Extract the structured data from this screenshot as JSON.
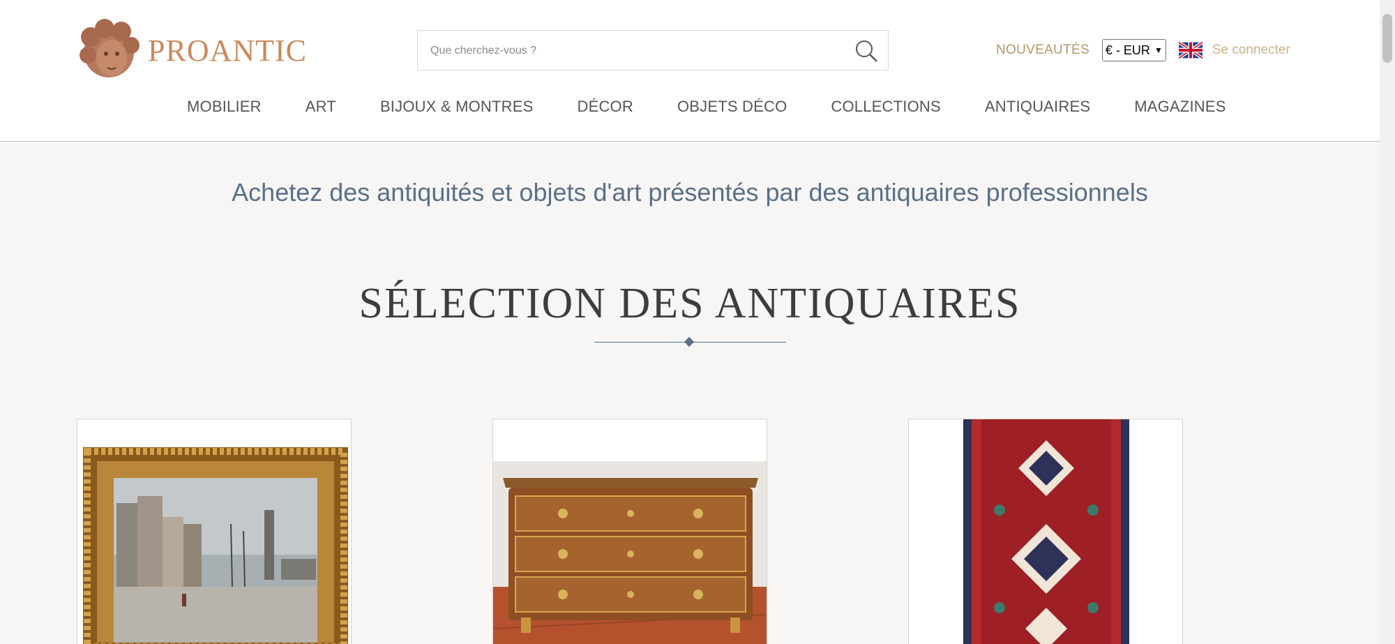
{
  "header": {
    "brand": "PROANTIC",
    "logo_icon": "cherub-head-logo",
    "search": {
      "placeholder": "Que cherchez-vous ?"
    },
    "nouveautes_label": "NOUVEAUTÉS",
    "currency": "€ - EUR",
    "language_flag": "uk-flag-icon",
    "login_label": "Se connecter"
  },
  "nav": {
    "items": [
      "MOBILIER",
      "ART",
      "BIJOUX & MONTRES",
      "DÉCOR",
      "OBJETS DÉCO",
      "COLLECTIONS",
      "ANTIQUAIRES",
      "MAGAZINES"
    ]
  },
  "tagline": "Achetez des antiquités et objets d'art présentés par des antiquaires professionnels",
  "section": {
    "title": "SÉLECTION DES ANTIQUAIRES",
    "products": [
      {
        "kind": "framed-harbour-painting"
      },
      {
        "kind": "marquetry-commode"
      },
      {
        "kind": "red-oriental-rug"
      }
    ]
  },
  "colors": {
    "accent_gold": "#b2976a",
    "brand_copper": "#c98a5a",
    "slate_blue": "#5a6f88",
    "background": "#f7f6f4"
  }
}
